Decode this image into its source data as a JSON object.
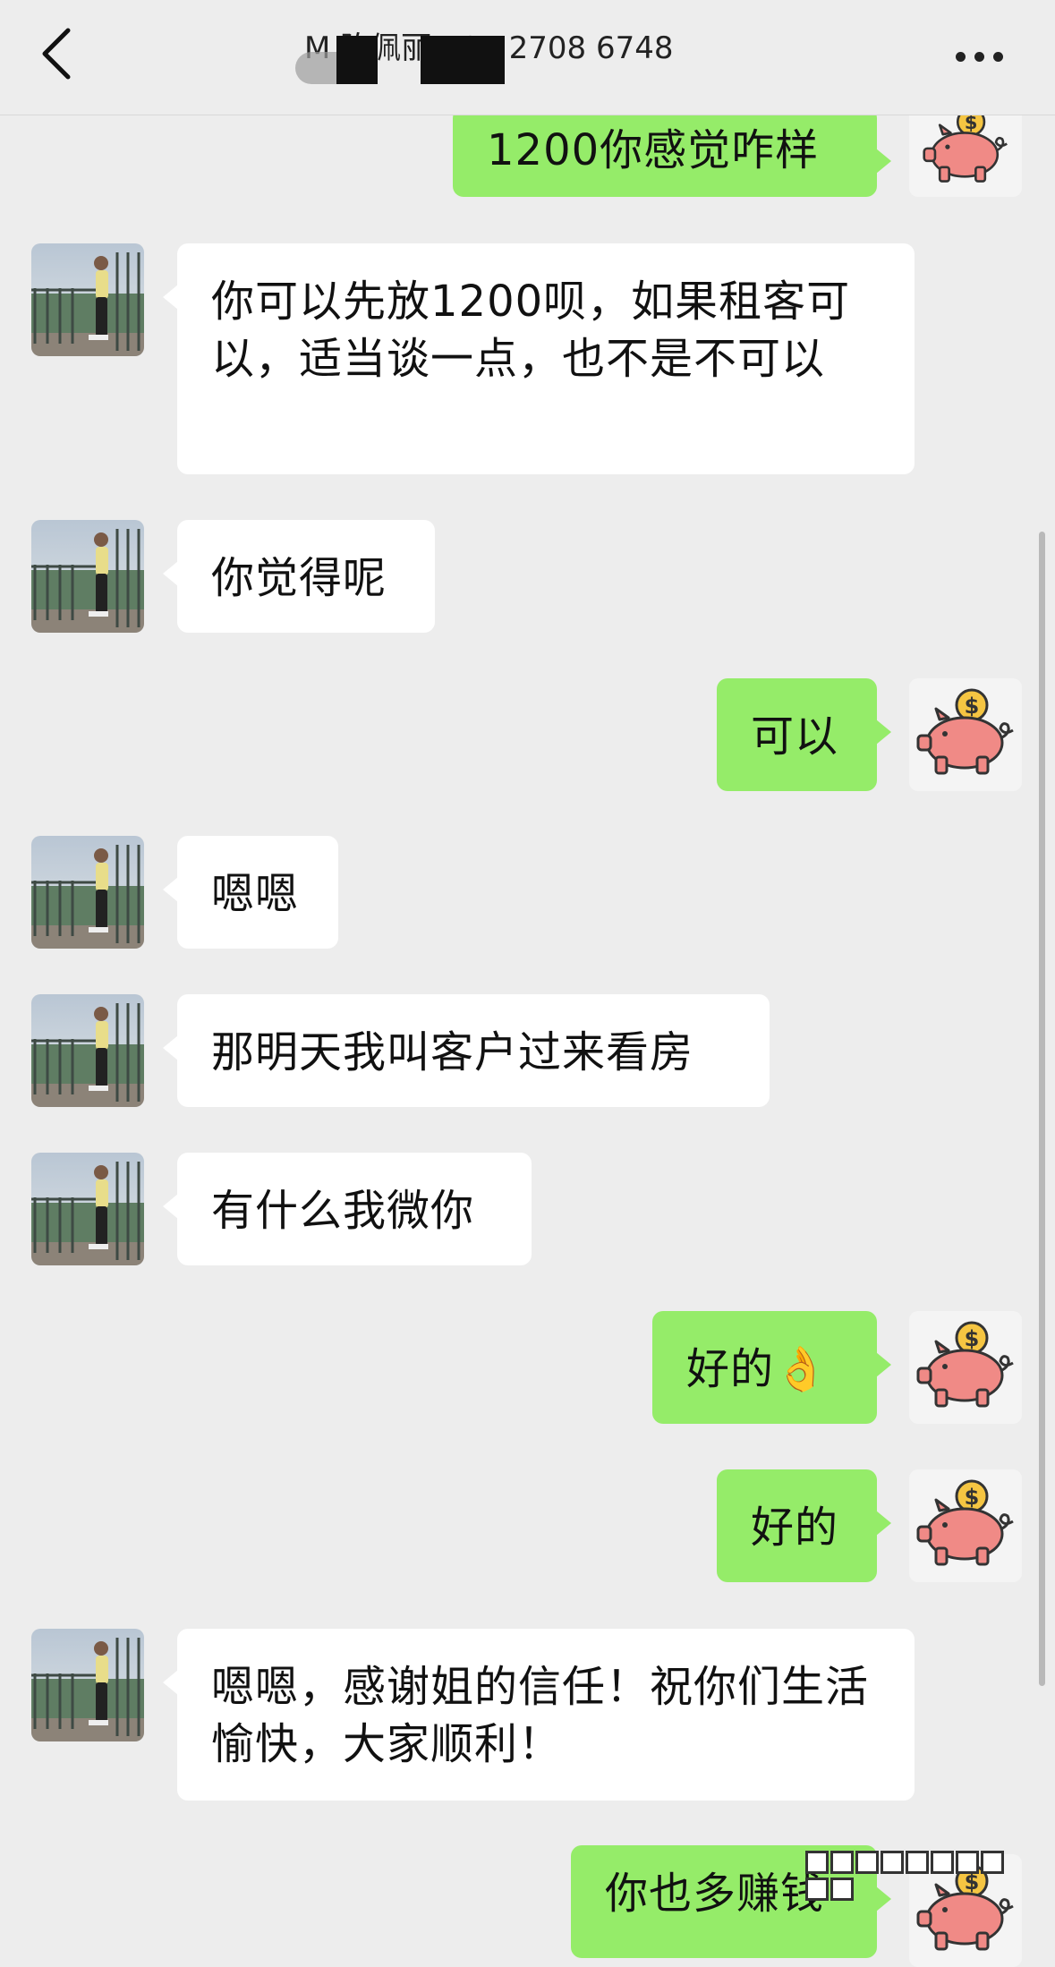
{
  "header": {
    "title": "M 陈佩丽 187 2708 6748"
  },
  "messages": [
    {
      "side": "right",
      "text": "1200你感觉咋样"
    },
    {
      "side": "left",
      "text": "你可以先放1200呗，如果租客可以，适当谈一点，也不是不可以"
    },
    {
      "side": "left",
      "text": "你觉得呢"
    },
    {
      "side": "right",
      "text": "可以"
    },
    {
      "side": "left",
      "text": "嗯嗯"
    },
    {
      "side": "left",
      "text": "那明天我叫客户过来看房"
    },
    {
      "side": "left",
      "text": "有什么我微你"
    },
    {
      "side": "right",
      "text": "好的👌"
    },
    {
      "side": "right",
      "text": "好的"
    },
    {
      "side": "left",
      "text": "嗯嗯，感谢姐的信任！祝你们生活愉快，大家顺利！"
    },
    {
      "side": "right",
      "text": "你也多赚钱"
    }
  ],
  "icons": {
    "back": "chevron-left-icon",
    "more": "more-dots-icon",
    "self_avatar": "piggy-bank-icon",
    "other_avatar": "photo-avatar"
  },
  "colors": {
    "background": "#ededed",
    "self_bubble": "#95ec69",
    "other_bubble": "#ffffff",
    "piggy": "#f08a86",
    "coin": "#f5c542"
  }
}
